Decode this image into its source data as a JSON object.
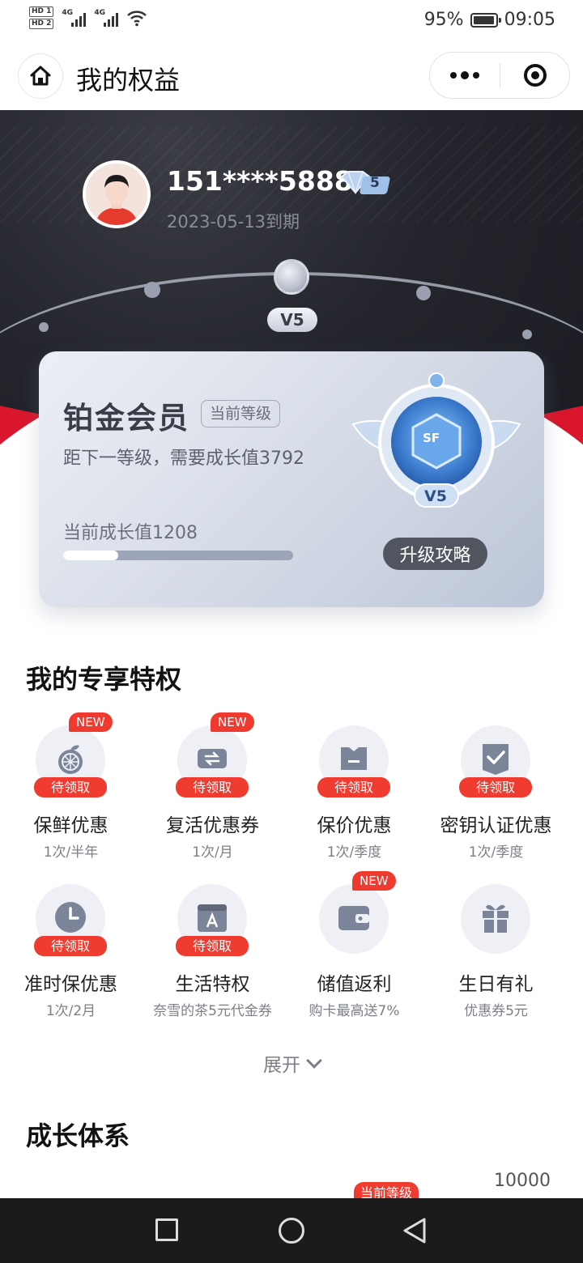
{
  "status_bar": {
    "battery": "95%",
    "time": "09:05",
    "hd1": "HD 1",
    "hd2": "HD 2",
    "net1": "4G",
    "net2": "4G"
  },
  "nav": {
    "title": "我的权益"
  },
  "profile": {
    "phone": "151****5888",
    "expire": "2023-05-13到期",
    "vip_level_num": "5",
    "track_level": "V5"
  },
  "level_card": {
    "name": "铂金会员",
    "tag": "当前等级",
    "next_need": "距下一等级，需要成长值3792",
    "current_growth": "当前成长值1208",
    "progress": 0.24,
    "upgrade_button": "升级攻略",
    "medal_level": "V5",
    "medal_text": "SF"
  },
  "privileges": {
    "title": "我的专享特权",
    "new_label": "NEW",
    "pending_label": "待领取",
    "items": [
      {
        "name": "保鲜优惠",
        "sub": "1次/半年",
        "icon": "orange-icon",
        "is_new": true,
        "pending": true
      },
      {
        "name": "复活优惠券",
        "sub": "1次/月",
        "icon": "coupon-refresh-icon",
        "is_new": true,
        "pending": true
      },
      {
        "name": "保价优惠",
        "sub": "1次/季度",
        "icon": "price-protect-icon",
        "is_new": false,
        "pending": true
      },
      {
        "name": "密钥认证优惠",
        "sub": "1次/季度",
        "icon": "key-check-icon",
        "is_new": false,
        "pending": true
      },
      {
        "name": "准时保优惠",
        "sub": "1次/2月",
        "icon": "clock-icon",
        "is_new": false,
        "pending": true
      },
      {
        "name": "生活特权",
        "sub": "奈雪的茶5元代金券",
        "icon": "life-bag-icon",
        "is_new": false,
        "pending": true
      },
      {
        "name": "储值返利",
        "sub": "购卡最高送7%",
        "icon": "wallet-icon",
        "is_new": true,
        "pending": false
      },
      {
        "name": "生日有礼",
        "sub": "优惠券5元",
        "icon": "gift-icon",
        "is_new": false,
        "pending": false
      }
    ],
    "expand_label": "展开"
  },
  "growth_system": {
    "title": "成长体系",
    "current_tag": "当前等级",
    "max_value": "10000"
  },
  "colors": {
    "accent_red": "#ef3b30",
    "hero_dark": "#24252c",
    "brand_red": "#d9162c",
    "card_silver": "#d4dae6"
  }
}
